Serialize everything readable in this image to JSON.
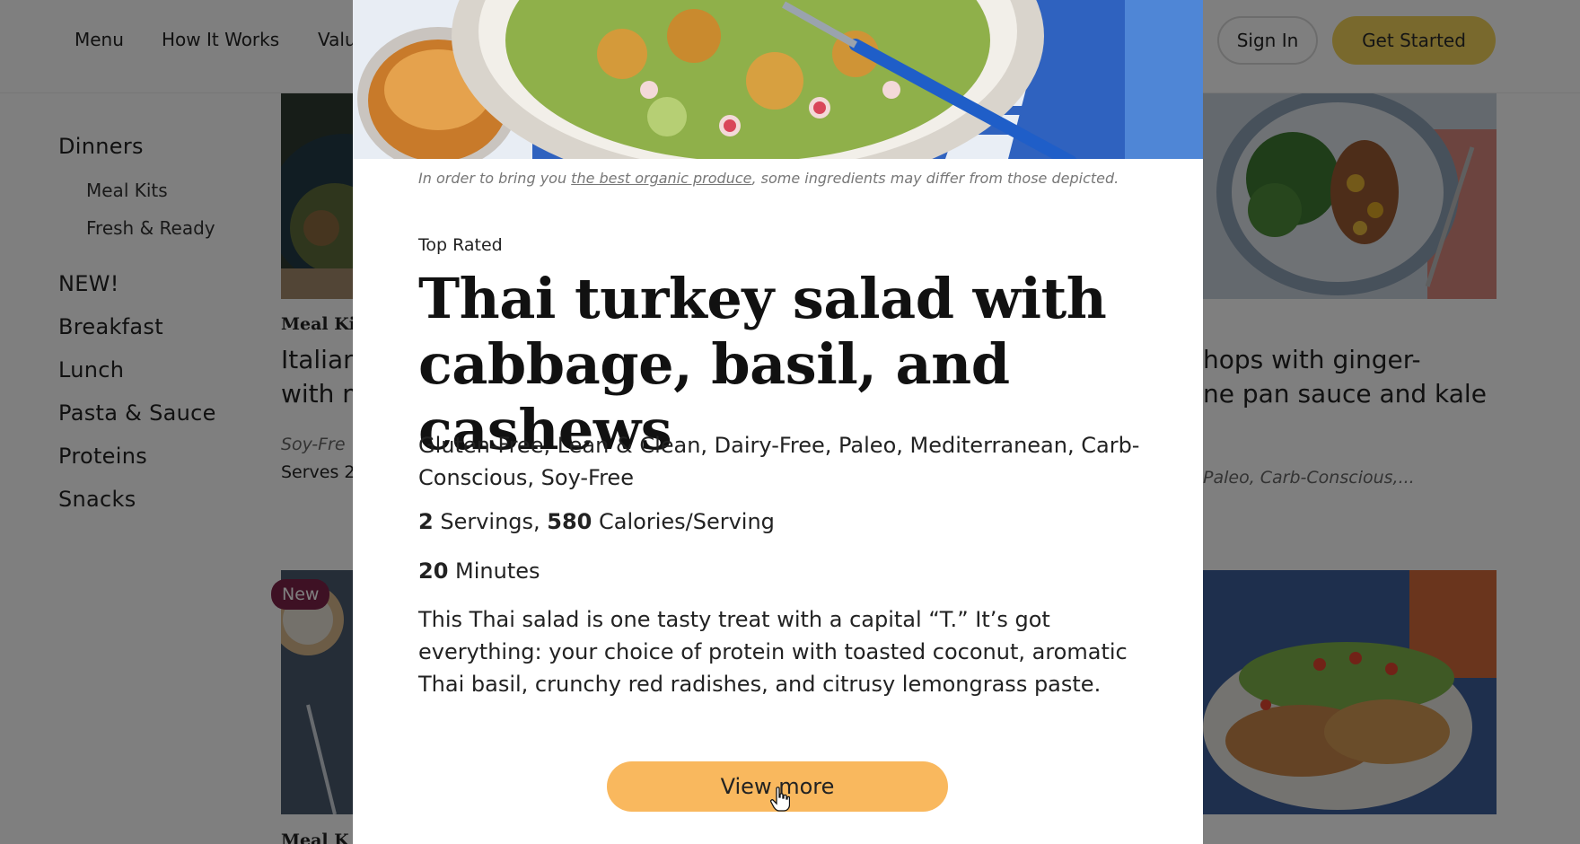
{
  "header": {
    "nav": [
      "Menu",
      "How It Works",
      "Valu"
    ],
    "signin_label": "Sign In",
    "get_started_label": "Get Started"
  },
  "sidebar": {
    "categories": [
      {
        "label": "Dinners",
        "children": [
          "Meal Kits",
          "Fresh & Ready"
        ]
      },
      {
        "label": "NEW!"
      },
      {
        "label": "Breakfast"
      },
      {
        "label": "Lunch"
      },
      {
        "label": "Pasta & Sauce"
      },
      {
        "label": "Proteins"
      },
      {
        "label": "Snacks"
      }
    ]
  },
  "cards": {
    "left_top": {
      "tag": "Meal Kit",
      "title_line1": "Italian",
      "title_line2": "with m",
      "meta": "Soy-Fre",
      "serves": "Serves 2"
    },
    "right_top": {
      "title_line1": "hops with ginger-",
      "title_line2": "ne pan sauce and kale",
      "meta": "Paleo, Carb-Conscious,..."
    },
    "left_bottom": {
      "badge": "New",
      "tag": "Meal K"
    }
  },
  "modal": {
    "disclaimer_before": "In order to bring you ",
    "disclaimer_link": "the best organic produce",
    "disclaimer_after": ", some ingredients may differ from those depicted.",
    "eyebrow": "Top Rated",
    "title": "Thai turkey salad with cabbage, basil, and cashews",
    "tags": "Gluten-Free, Lean & Clean, Dairy-Free, Paleo, Mediterranean, Carb-Conscious, Soy-Free",
    "servings_count": "2",
    "servings_label": " Servings, ",
    "calories": "580",
    "calories_label": " Calories/Serving",
    "minutes_count": "20",
    "minutes_label": " Minutes",
    "description": "This Thai salad is one tasty treat with a capital “T.” It’s got everything: your choice of protein with toasted coconut, aromatic Thai basil, crunchy red radishes, and citrusy lemongrass paste.",
    "view_more_label": "View more"
  },
  "colors": {
    "get_started_bg": "#f2d35a",
    "view_more_bg": "#f9b85e",
    "badge_new_bg": "#7d2249",
    "overlay": "rgba(0,0,0,0.5)"
  }
}
